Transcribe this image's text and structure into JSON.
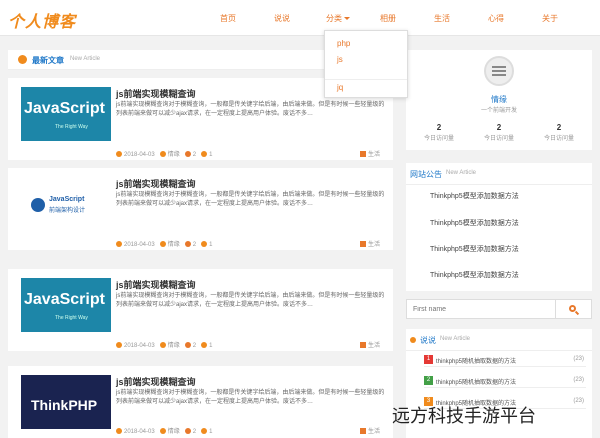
{
  "header": {
    "logo": "个人博客",
    "nav": [
      "首页",
      "说说",
      "分类",
      "相册",
      "生活",
      "心得",
      "关于"
    ],
    "dropdown": [
      "php",
      "js",
      "jq"
    ]
  },
  "main": {
    "section_title": "最新文章",
    "section_sub": "New Article",
    "articles": [
      {
        "thumb_text": "JavaScript",
        "thumb_sub": "The Right Way",
        "title": "js前端实现模糊查询",
        "desc": "js前端实现模糊查询对于模糊查询，一般都是传关键字给后端，由后端来做。但是有时候一些轻量级的列表前端来做可以减少ajax请求，在一定程度上提高用户体验。废话不多…",
        "date": "2018-04-03",
        "author": "情缘",
        "likes": "2",
        "views": "1",
        "category": "生活"
      },
      {
        "thumb_text": "JavaScript",
        "thumb_sub": "前端架构设计",
        "title": "js前端实现模糊查询",
        "desc": "js前端实现模糊查询对于模糊查询，一般都是传关键字给后端，由后端来做。但是有时候一些轻量级的列表前端来做可以减少ajax请求，在一定程度上提高用户体验。废话不多…",
        "date": "2018-04-03",
        "author": "情缘",
        "likes": "2",
        "views": "1",
        "category": "生活"
      },
      {
        "thumb_text": "JavaScript",
        "thumb_sub": "The Right Way",
        "title": "js前端实现模糊查询",
        "desc": "js前端实现模糊查询对于模糊查询，一般都是传关键字给后端，由后端来做。但是有时候一些轻量级的列表前端来做可以减少ajax请求，在一定程度上提高用户体验。废话不多…",
        "date": "2018-04-03",
        "author": "情缘",
        "likes": "2",
        "views": "1",
        "category": "生活"
      },
      {
        "thumb_text": "ThinkPHP",
        "thumb_sub": "",
        "title": "js前端实现模糊查询",
        "desc": "js前端实现模糊查询对于模糊查询，一般都是传关键字给后端，由后端来做。但是有时候一些轻量级的列表前端来做可以减少ajax请求，在一定程度上提高用户体验。废话不多…",
        "date": "2018-04-03",
        "author": "情缘",
        "likes": "2",
        "views": "1",
        "category": "生活"
      }
    ]
  },
  "sidebar": {
    "profile": {
      "name": "情缘",
      "title": "一个前端开发",
      "stats": [
        {
          "value": "2",
          "label": "今日访问量"
        },
        {
          "value": "2",
          "label": "今日访问量"
        },
        {
          "value": "2",
          "label": "今日访问量"
        }
      ]
    },
    "notice": {
      "title": "网站公告",
      "sub": "New Article",
      "items": [
        "Thinkphp5模型添加数据方法",
        "Thinkphp5模型添加数据方法",
        "Thinkphp5模型添加数据方法",
        "Thinkphp5模型添加数据方法"
      ]
    },
    "search": {
      "placeholder": "First name"
    },
    "talk": {
      "title": "说说",
      "sub": "New Article",
      "items": [
        {
          "rank": "1",
          "text": "thinkphp5随机抽取数据的方法",
          "count": "(23)",
          "color": "#e53935"
        },
        {
          "rank": "2",
          "text": "thinkphp5随机抽取数据的方法",
          "count": "(23)",
          "color": "#43a047"
        },
        {
          "rank": "3",
          "text": "thinkphp5随机抽取数据的方法",
          "count": "(23)",
          "color": "#f08b1d"
        }
      ]
    }
  },
  "watermark": "远方科技手游平台"
}
